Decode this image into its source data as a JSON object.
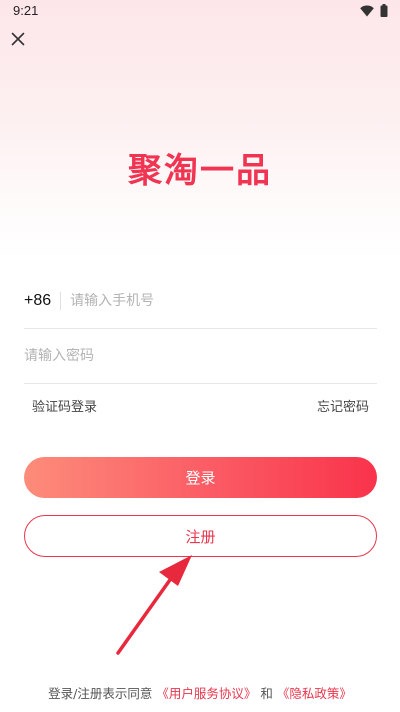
{
  "status_bar": {
    "time": "9:21",
    "icons": [
      "wifi-icon",
      "battery-icon"
    ]
  },
  "header": {
    "close_icon": "close-icon"
  },
  "app_title": "聚淘一品",
  "phone_field": {
    "country_code": "+86",
    "placeholder": "请输入手机号",
    "value": ""
  },
  "password_field": {
    "placeholder": "请输入密码",
    "value": ""
  },
  "links": {
    "sms_login": "验证码登录",
    "forgot_password": "忘记密码"
  },
  "buttons": {
    "login": "登录",
    "register": "注册"
  },
  "agreement": {
    "prefix": "登录/注册表示同意",
    "user_agreement": "《用户服务协议》",
    "conjunction": "和",
    "privacy_policy": "《隐私政策》"
  },
  "colors": {
    "accent": "#f03553",
    "button_gradient_start": "#fd8c7a",
    "button_gradient_end": "#f9334b"
  }
}
